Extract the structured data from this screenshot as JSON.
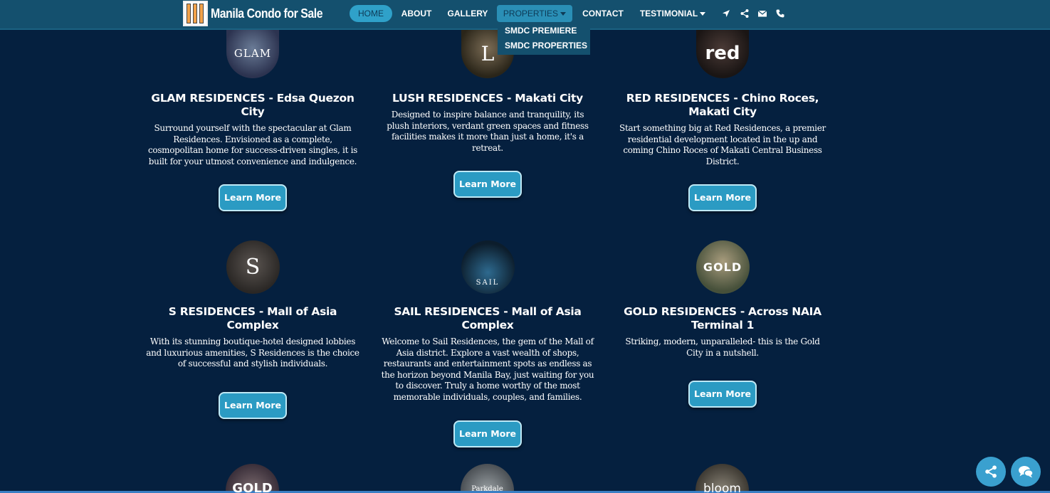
{
  "brand": {
    "name": "Manila Condo for Sale",
    "logo_icon": "building-logo-icon"
  },
  "nav": {
    "home": "HOME",
    "about": "ABOUT",
    "gallery": "GALLERY",
    "properties": "PROPERTIES",
    "contact": "CONTACT",
    "testimonial": "TESTIMONIAL",
    "icons": [
      "location-arrow-icon",
      "share-icon",
      "envelope-icon",
      "phone-icon"
    ]
  },
  "dropdown": {
    "items": [
      "SMDC PREMIERE",
      "SMDC PROPERTIES"
    ]
  },
  "cards": [
    {
      "thumb": "GLAM",
      "title": "GLAM RESIDENCES - Edsa Quezon City",
      "text": "Surround yourself with the spectacular at Glam Residences. Envisioned as a complete, cosmopolitan home for success-driven singles, it is built for your utmost convenience and indulgence.",
      "button": "Learn More"
    },
    {
      "thumb": "L",
      "title": "LUSH RESIDENCES - Makati City",
      "text": "Designed to inspire balance and tranquility, its plush interiors, verdant green spaces and fitness facilities makes it more than just a home, it's a retreat.",
      "button": "Learn More"
    },
    {
      "thumb": "red",
      "title": "RED RESIDENCES - Chino Roces, Makati City",
      "text": "Start something big at Red Residences, a premier residential development located in the up and coming Chino Roces of Makati Central Business District.",
      "button": "Learn More"
    },
    {
      "thumb": "S",
      "title": "S RESIDENCES - Mall of Asia Complex",
      "text": "With its stunning boutique-hotel designed lobbies and luxurious amenities, S Residences is the choice of successful and stylish individuals.",
      "button": "Learn More"
    },
    {
      "thumb": "SAIL",
      "title": "SAIL RESIDENCES - Mall of Asia Complex",
      "text": "Welcome to Sail Residences, the gem of the Mall of Asia district. Explore a vast wealth of shops, restaurants and entertainment spots as endless as the horizon beyond Manila Bay, just waiting for you to discover. Truly a home worthy of the most memorable individuals, couples, and families.",
      "button": "Learn More"
    },
    {
      "thumb": "GOLD",
      "title": "GOLD RESIDENCES - Across NAIA Terminal 1",
      "text": "Striking, modern, unparalleled- this is the Gold City in a nutshell.",
      "button": "Learn More"
    }
  ],
  "partial_thumbs": [
    "GOLD",
    "Parkdale",
    "bloom"
  ],
  "fabs": [
    "share-icon",
    "chat-icon"
  ]
}
